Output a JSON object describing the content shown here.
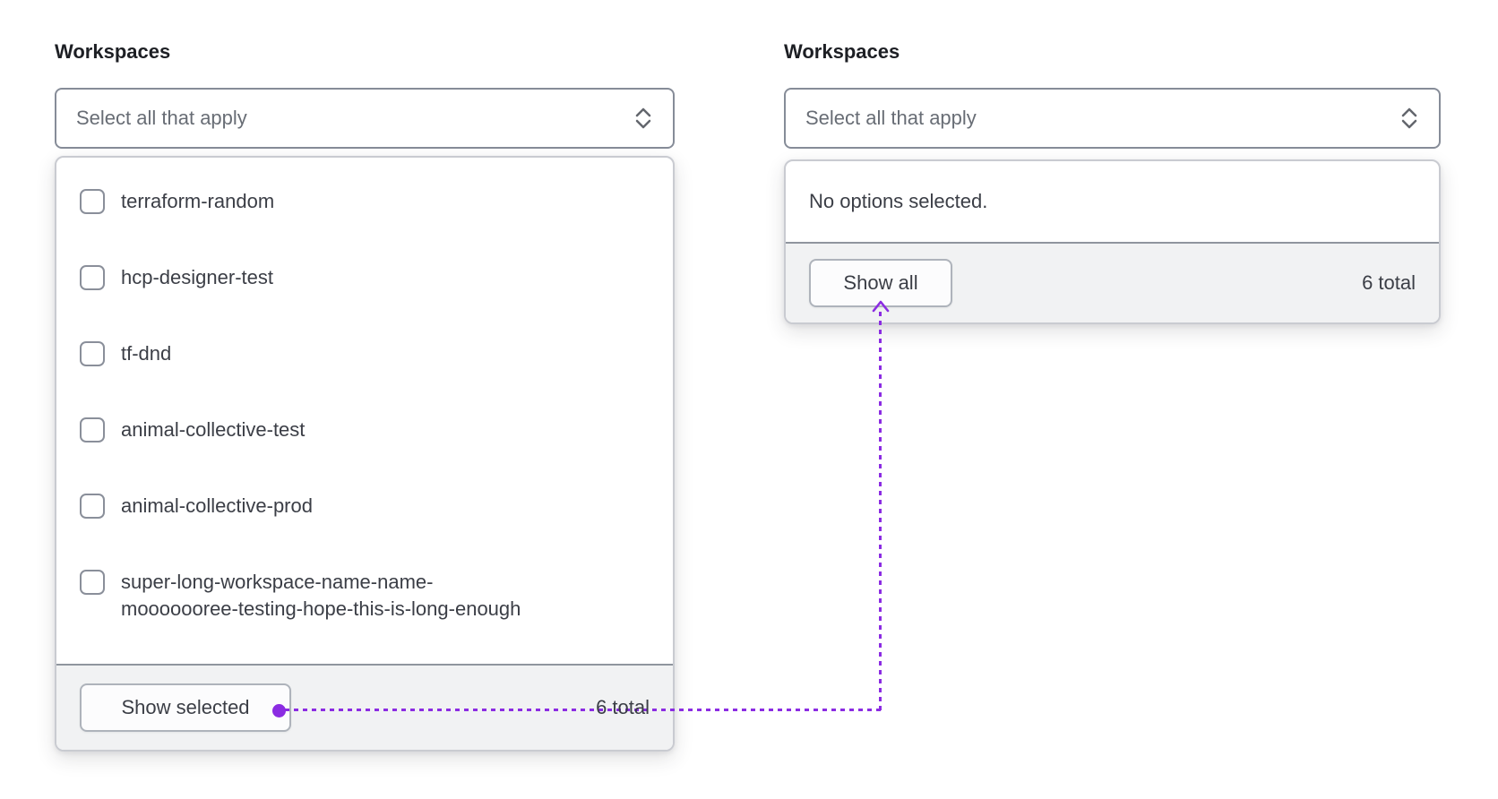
{
  "left_select": {
    "label": "Workspaces",
    "placeholder": "Select all that apply",
    "options": [
      "terraform-random",
      "hcp-designer-test",
      "tf-dnd",
      "animal-collective-test",
      "animal-collective-prod",
      "super-long-workspace-name-name-mooooooree-testing-hope-this-is-long-enough"
    ],
    "toggle_label": "Show selected",
    "total_label": "6 total"
  },
  "right_select": {
    "label": "Workspaces",
    "placeholder": "Select all that apply",
    "empty_message": "No options selected.",
    "toggle_label": "Show all",
    "total_label": "6 total"
  },
  "annotation": {
    "accent_color": "#8b2ce2"
  },
  "icons": {
    "trigger_caret": "caret-up-down-icon",
    "connector_arrow": "arrow-up-icon"
  }
}
